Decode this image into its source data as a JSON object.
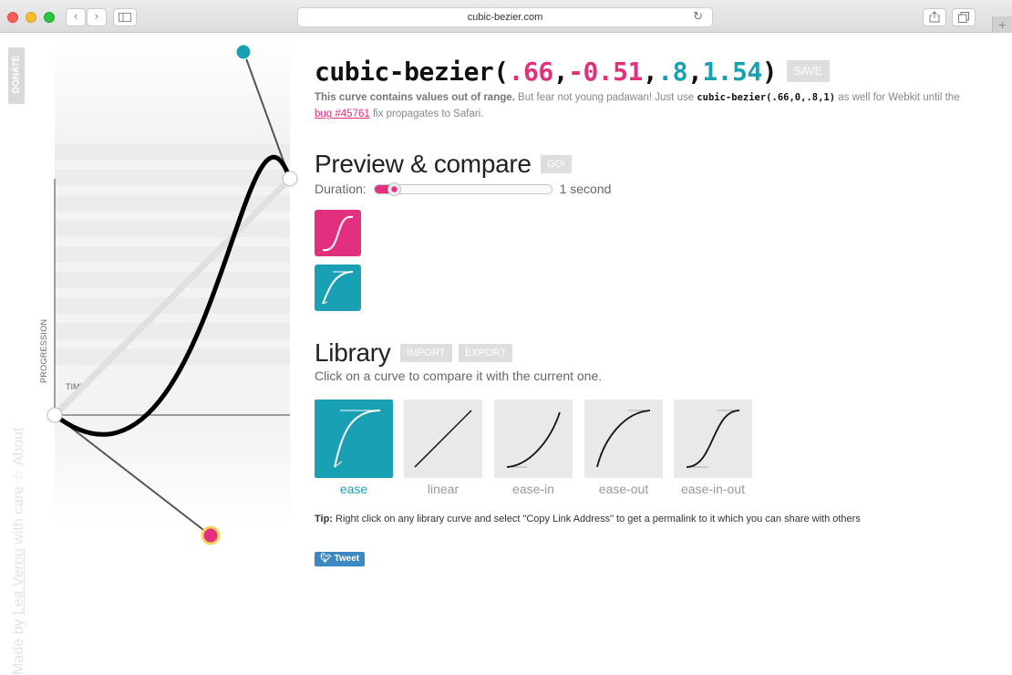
{
  "browser": {
    "url": "cubic-bezier.com",
    "back_icon": "chevron-left-icon",
    "forward_icon": "chevron-right-icon",
    "reload_glyph": "↻",
    "back_glyph": "‹",
    "forward_glyph": "›",
    "plus_glyph": "+"
  },
  "sidebar": {
    "donate_label": "DONATE",
    "about_label": "About",
    "credit_prefix": "Made by ",
    "credit_author": "Lea Verou",
    "credit_suffix": " with care ☆ "
  },
  "graph": {
    "y_axis_label": "PROGRESSION",
    "x_axis_label": "TIME",
    "curve": [
      0.66,
      -0.51,
      0.8,
      1.54
    ]
  },
  "header": {
    "title_prefix": "cubic-bezier(",
    "p1x": ".66",
    "sep1": ",",
    "p1y": "-0.51",
    "sep2": ",",
    "p2x": ".8",
    "sep3": ",",
    "p2y": "1.54",
    "title_suffix": ")",
    "save_label": "SAVE"
  },
  "warning": {
    "bold": "This curve contains values out of range.",
    "text1": " But fear not young padawan! Just use ",
    "code": "cubic-bezier(.66,0,.8,1)",
    "text2": " as well for Webkit until the ",
    "link": "bug #45761",
    "text3": " fix propagates to Safari."
  },
  "preview": {
    "heading": "Preview & compare",
    "go_label": "GO!",
    "duration_label": "Duration:",
    "duration_value": "1 second",
    "duration_fraction": 0.05
  },
  "library": {
    "heading": "Library",
    "import_label": "IMPORT",
    "export_label": "EXPORT",
    "description": "Click on a curve to compare it with the current one.",
    "items": [
      {
        "label": "ease"
      },
      {
        "label": "linear"
      },
      {
        "label": "ease-in"
      },
      {
        "label": "ease-out"
      },
      {
        "label": "ease-in-out"
      }
    ]
  },
  "tip": {
    "bold": "Tip:",
    "text": " Right click on any library curve and select \"Copy Link Address\" to get a permalink to it which you can share with others"
  },
  "tweet_label": "Tweet",
  "colors": {
    "pink": "#e3307e",
    "teal": "#1aa0b4"
  }
}
